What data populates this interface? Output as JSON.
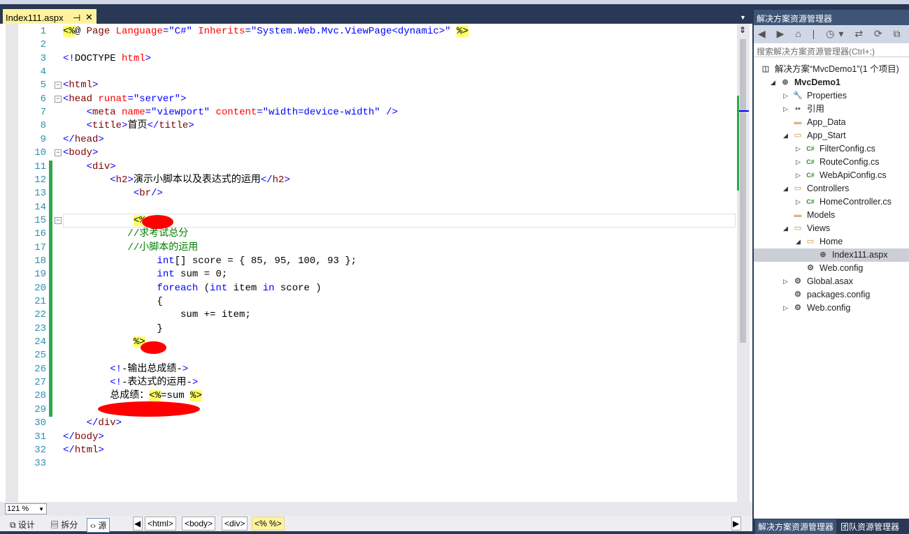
{
  "editor": {
    "tab_title": "Index111.aspx",
    "pin_icon": "⊣",
    "close_icon": "✕",
    "lines": [
      [
        [
          "<%",
          "hl"
        ],
        [
          "@ ",
          "tx"
        ],
        [
          "Page ",
          "tg"
        ],
        [
          "Language",
          "at"
        ],
        [
          "=\"C#\" ",
          "vl"
        ],
        [
          "Inherits",
          "at"
        ],
        [
          "=\"System.Web.Mvc.ViewPage<dynamic>\" ",
          "vl"
        ],
        [
          "%>",
          "hl"
        ]
      ],
      [],
      [
        [
          "<!",
          "br"
        ],
        [
          "DOCTYPE ",
          "tx"
        ],
        [
          "html",
          "at"
        ],
        [
          ">",
          "br"
        ]
      ],
      [],
      [
        [
          "<",
          "br"
        ],
        [
          "html",
          "tg"
        ],
        [
          ">",
          "br"
        ]
      ],
      [
        [
          "<",
          "br"
        ],
        [
          "head ",
          "tg"
        ],
        [
          "runat",
          "at"
        ],
        [
          "=\"server\"",
          "vl"
        ],
        [
          ">",
          "br"
        ]
      ],
      [
        [
          "    <",
          "br"
        ],
        [
          "meta ",
          "tg"
        ],
        [
          "name",
          "at"
        ],
        [
          "=\"viewport\" ",
          "vl"
        ],
        [
          "content",
          "at"
        ],
        [
          "=\"width=device-width\" ",
          "vl"
        ],
        [
          "/>",
          "br"
        ]
      ],
      [
        [
          "    <",
          "br"
        ],
        [
          "title",
          "tg"
        ],
        [
          ">",
          "br"
        ],
        [
          "首页",
          "tx"
        ],
        [
          "</",
          "br"
        ],
        [
          "title",
          "tg"
        ],
        [
          ">",
          "br"
        ]
      ],
      [
        [
          "</",
          "br"
        ],
        [
          "head",
          "tg"
        ],
        [
          ">",
          "br"
        ]
      ],
      [
        [
          "<",
          "br"
        ],
        [
          "body",
          "tg"
        ],
        [
          ">",
          "br"
        ]
      ],
      [
        [
          "    <",
          "br"
        ],
        [
          "div",
          "tg"
        ],
        [
          ">",
          "br"
        ]
      ],
      [
        [
          "        <",
          "br"
        ],
        [
          "h2",
          "tg"
        ],
        [
          ">",
          "br"
        ],
        [
          "演示小脚本以及表达式的运用",
          "tx"
        ],
        [
          "</",
          "br"
        ],
        [
          "h2",
          "tg"
        ],
        [
          ">",
          "br"
        ]
      ],
      [
        [
          "            <",
          "br"
        ],
        [
          "br",
          "tg"
        ],
        [
          "/>",
          "br"
        ]
      ],
      [],
      [
        [
          "            ",
          "tx"
        ],
        [
          "<%",
          "hl"
        ]
      ],
      [
        [
          "           //求考试总分",
          "cm"
        ]
      ],
      [
        [
          "           //小脚本的运用",
          "cm"
        ]
      ],
      [
        [
          "                ",
          "tx"
        ],
        [
          "int",
          "kw"
        ],
        [
          "[] score = { 85, 95, 100, 93 };",
          "tx"
        ]
      ],
      [
        [
          "                ",
          "tx"
        ],
        [
          "int",
          "kw"
        ],
        [
          " sum = 0;",
          "tx"
        ]
      ],
      [
        [
          "                ",
          "tx"
        ],
        [
          "foreach",
          "kw"
        ],
        [
          " (",
          "tx"
        ],
        [
          "int",
          "kw"
        ],
        [
          " item ",
          "tx"
        ],
        [
          "in",
          "kw"
        ],
        [
          " score )",
          "tx"
        ]
      ],
      [
        [
          "                {",
          "tx"
        ]
      ],
      [
        [
          "                    sum += item;",
          "tx"
        ]
      ],
      [
        [
          "                }",
          "tx"
        ]
      ],
      [
        [
          "            ",
          "tx"
        ],
        [
          "%>",
          "hl"
        ]
      ],
      [],
      [
        [
          "        <!",
          "br"
        ],
        [
          "-输出总成绩-",
          "tx"
        ],
        [
          ">",
          "br"
        ]
      ],
      [
        [
          "        <!",
          "br"
        ],
        [
          "-表达式的运用-",
          "tx"
        ],
        [
          ">",
          "br"
        ]
      ],
      [
        [
          "        总成绩：",
          "tx"
        ],
        [
          "<%",
          "hl"
        ],
        [
          "=sum ",
          "tx"
        ],
        [
          "%>",
          "hl"
        ]
      ],
      [],
      [
        [
          "    </",
          "br"
        ],
        [
          "div",
          "tg"
        ],
        [
          ">",
          "br"
        ]
      ],
      [
        [
          "</",
          "br"
        ],
        [
          "body",
          "tg"
        ],
        [
          ">",
          "br"
        ]
      ],
      [
        [
          "</",
          "br"
        ],
        [
          "html",
          "tg"
        ],
        [
          ">",
          "br"
        ]
      ],
      []
    ],
    "folds": [
      5,
      6,
      10,
      15
    ],
    "changed": [
      11,
      12,
      13,
      14,
      15,
      16,
      17,
      18,
      19,
      20,
      21,
      22,
      23,
      24,
      25,
      26,
      27,
      28,
      29
    ]
  },
  "statusbar": {
    "zoom": "121 %",
    "views": [
      {
        "icon": "design-icon",
        "glyph": "⧉",
        "label": "设计"
      },
      {
        "icon": "split-icon",
        "glyph": "▤",
        "label": "拆分"
      },
      {
        "icon": "source-icon",
        "glyph": "‹›",
        "label": "源"
      }
    ],
    "breadcrumbs": [
      "<html>",
      "<body>",
      "<div>",
      "<% %>"
    ]
  },
  "solution_explorer": {
    "title": "解决方案资源管理器",
    "toolbar_icons": "◀ ▶ ⌂ | ◷▾ ⇄ ⟳ ⧉ ⎘ | <",
    "search_placeholder": "搜索解决方案资源管理器(Ctrl+;)",
    "tree": [
      {
        "label": "解决方案“MvcDemo1”(1 个项目)",
        "level": 0,
        "arrow": "",
        "icon": "solution-icon",
        "glyph": "◫"
      },
      {
        "label": "MvcDemo1",
        "level": 1,
        "arrow": "◢",
        "icon": "web-project-icon",
        "glyph": "⊕",
        "bold": true
      },
      {
        "label": "Properties",
        "level": 2,
        "arrow": "▷",
        "icon": "wrench-icon",
        "glyph": "🔧"
      },
      {
        "label": "引用",
        "level": 2,
        "arrow": "▷",
        "icon": "references-icon",
        "glyph": "▪▪"
      },
      {
        "label": "App_Data",
        "level": 2,
        "arrow": "",
        "icon": "folder-icon",
        "glyph": "▬"
      },
      {
        "label": "App_Start",
        "level": 2,
        "arrow": "◢",
        "icon": "folder-open-icon",
        "glyph": "▭"
      },
      {
        "label": "FilterConfig.cs",
        "level": 3,
        "arrow": "▷",
        "icon": "csharp-file-icon",
        "glyph": "C#"
      },
      {
        "label": "RouteConfig.cs",
        "level": 3,
        "arrow": "▷",
        "icon": "csharp-file-icon",
        "glyph": "C#"
      },
      {
        "label": "WebApiConfig.cs",
        "level": 3,
        "arrow": "▷",
        "icon": "csharp-file-icon",
        "glyph": "C#"
      },
      {
        "label": "Controllers",
        "level": 2,
        "arrow": "◢",
        "icon": "folder-open-icon",
        "glyph": "▭"
      },
      {
        "label": "HomeController.cs",
        "level": 3,
        "arrow": "▷",
        "icon": "csharp-file-icon",
        "glyph": "C#"
      },
      {
        "label": "Models",
        "level": 2,
        "arrow": "",
        "icon": "folder-icon",
        "glyph": "▬"
      },
      {
        "label": "Views",
        "level": 2,
        "arrow": "◢",
        "icon": "folder-open-icon",
        "glyph": "▭"
      },
      {
        "label": "Home",
        "level": 3,
        "arrow": "◢",
        "icon": "folder-open-icon",
        "glyph": "▭"
      },
      {
        "label": "Index111.aspx",
        "level": 4,
        "arrow": "",
        "icon": "aspx-file-icon",
        "glyph": "⊕",
        "selected": true
      },
      {
        "label": "Web.config",
        "level": 3,
        "arrow": "",
        "icon": "config-file-icon",
        "glyph": "⚙"
      },
      {
        "label": "Global.asax",
        "level": 2,
        "arrow": "▷",
        "icon": "asax-file-icon",
        "glyph": "⚙"
      },
      {
        "label": "packages.config",
        "level": 2,
        "arrow": "",
        "icon": "config-file-icon",
        "glyph": "⚙"
      },
      {
        "label": "Web.config",
        "level": 2,
        "arrow": "▷",
        "icon": "config-file-icon",
        "glyph": "⚙"
      }
    ],
    "bottom_tabs": [
      "解决方案资源管理器",
      "团队资源管理器"
    ]
  },
  "colors": {
    "accent": "#fff29d",
    "changed_margin": "#2ea84a",
    "redaction": "#ff0000"
  }
}
